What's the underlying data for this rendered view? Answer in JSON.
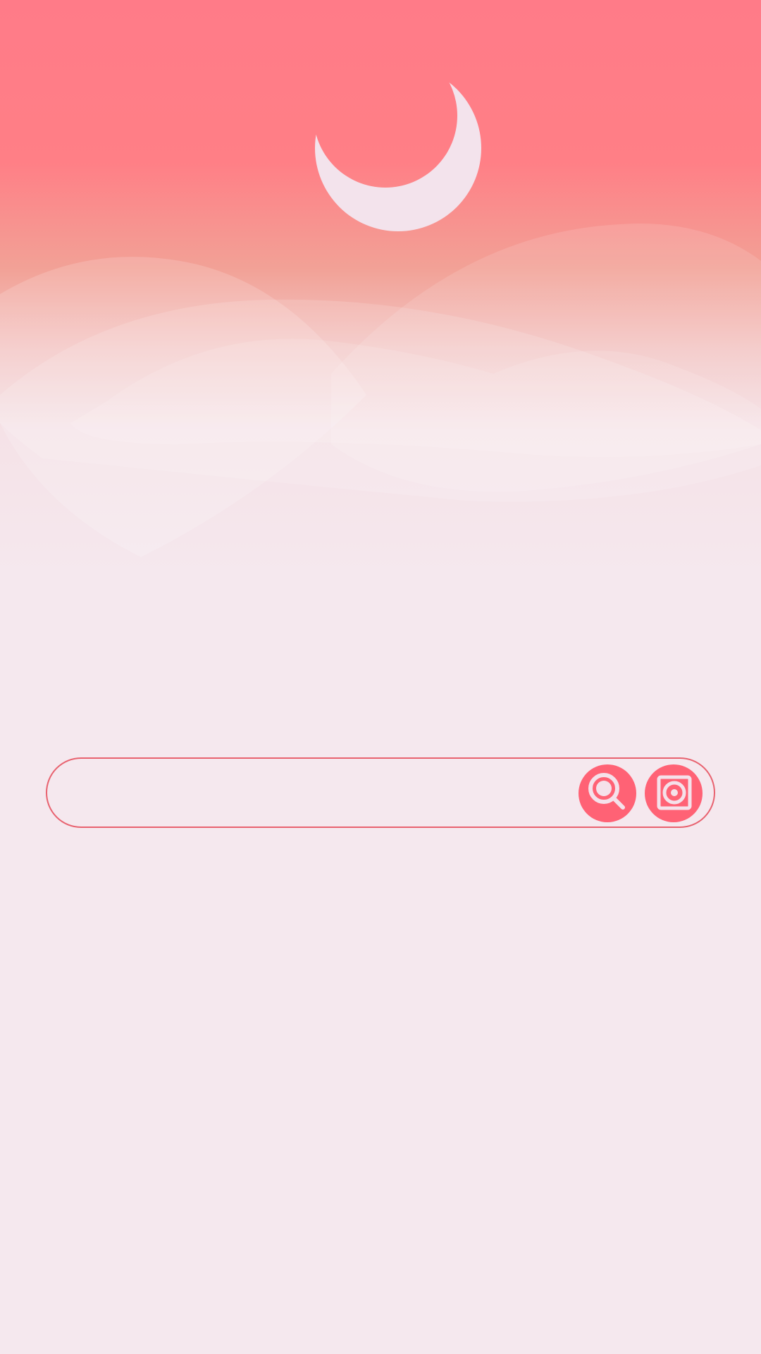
{
  "screen": {
    "theme_colors": {
      "sky_top": "#ff7b88",
      "sky_glow": "#f2a196",
      "background": "#f5e8ee",
      "accent": "#ff6275",
      "bar_border": "#e8626f",
      "moon": "#f3e3ec"
    }
  },
  "moon": {
    "icon": "crescent-moon"
  },
  "search": {
    "value": "",
    "placeholder": "",
    "search_icon": "magnifier-icon",
    "camera_icon": "camera-lens-icon"
  }
}
